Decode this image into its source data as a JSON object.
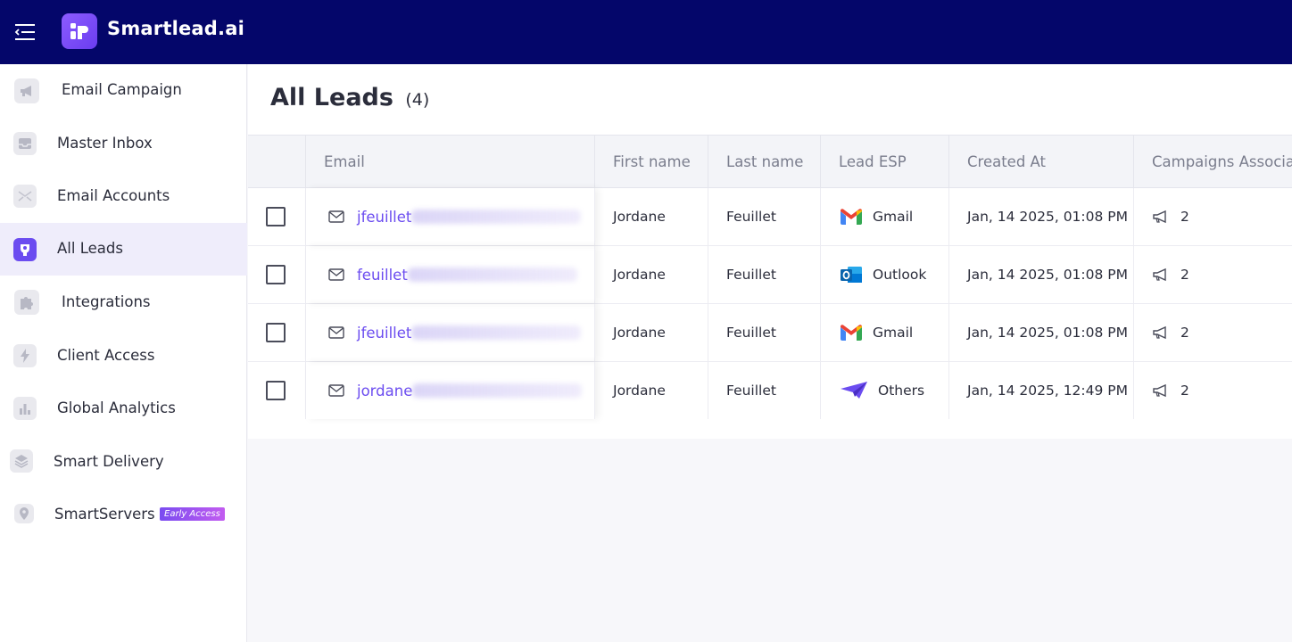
{
  "app": {
    "name": "Smartlead.ai"
  },
  "sidebar": {
    "items": [
      {
        "label": "Email Campaign",
        "icon": "megaphone-icon"
      },
      {
        "label": "Master Inbox",
        "icon": "inbox-icon"
      },
      {
        "label": "Email Accounts",
        "icon": "email-accounts-icon"
      },
      {
        "label": "All Leads",
        "icon": "leads-icon",
        "active": true
      },
      {
        "label": "Integrations",
        "icon": "puzzle-icon"
      },
      {
        "label": "Client Access",
        "icon": "lightning-icon"
      },
      {
        "label": "Global Analytics",
        "icon": "bar-chart-icon"
      },
      {
        "label": "Smart Delivery",
        "icon": "layers-icon"
      },
      {
        "label": "SmartServers",
        "icon": "location-pin-icon",
        "badge": "Early Access"
      }
    ]
  },
  "main": {
    "title": "All Leads",
    "count": "(4)",
    "table": {
      "columns": [
        "Email",
        "First name",
        "Last name",
        "Lead ESP",
        "Created At",
        "Campaigns Associa"
      ],
      "rows": [
        {
          "email": "jfeuillet",
          "first_name": "Jordane",
          "last_name": "Feuillet",
          "esp": "Gmail",
          "esp_icon": "gmail-icon",
          "created_at": "Jan, 14 2025, 01:08 PM",
          "campaigns": "2"
        },
        {
          "email": "feuillet",
          "first_name": "Jordane",
          "last_name": "Feuillet",
          "esp": "Outlook",
          "esp_icon": "outlook-icon",
          "created_at": "Jan, 14 2025, 01:08 PM",
          "campaigns": "2"
        },
        {
          "email": "jfeuillet",
          "first_name": "Jordane",
          "last_name": "Feuillet",
          "esp": "Gmail",
          "esp_icon": "gmail-icon",
          "created_at": "Jan, 14 2025, 01:08 PM",
          "campaigns": "2"
        },
        {
          "email": "jordane",
          "first_name": "Jordane",
          "last_name": "Feuillet",
          "esp": "Others",
          "esp_icon": "paper-plane-icon",
          "created_at": "Jan, 14 2025, 12:49 PM",
          "campaigns": "2"
        }
      ]
    }
  },
  "colors": {
    "topbar": "#04066a",
    "accent": "#6b4cf0",
    "active_nav_bg": "#efedfb"
  }
}
